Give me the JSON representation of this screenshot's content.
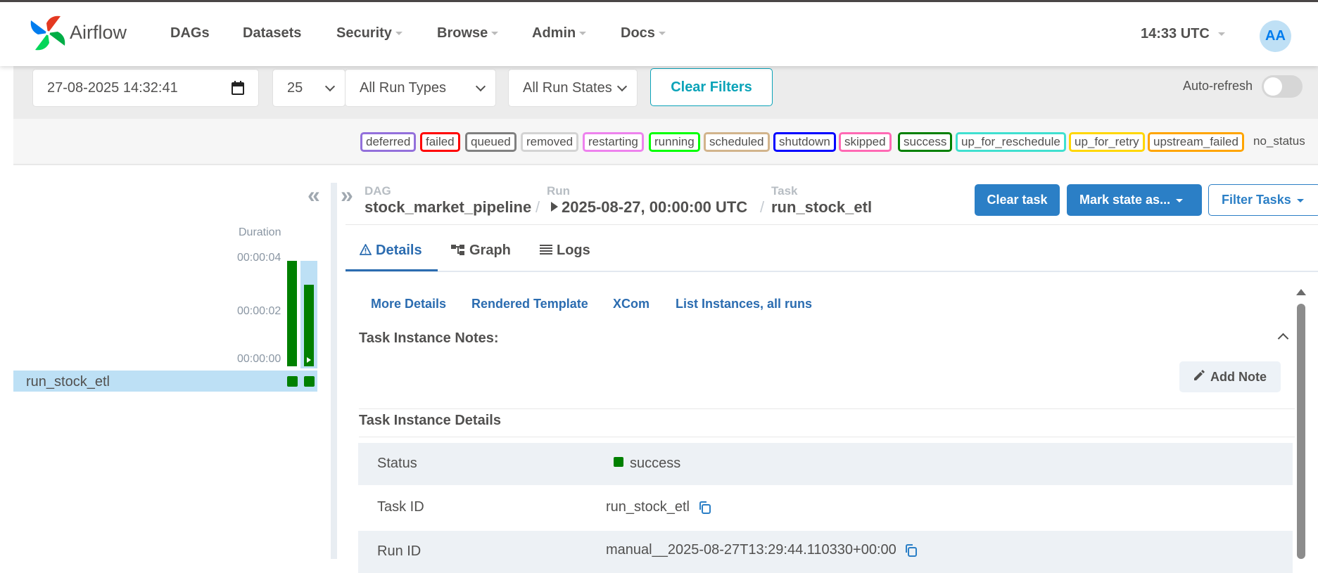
{
  "nav": {
    "brand": "Airflow",
    "items": [
      "DAGs",
      "Datasets",
      "Security",
      "Browse",
      "Admin",
      "Docs"
    ],
    "clock": "14:33 UTC",
    "avatar": "AA"
  },
  "filters": {
    "datetime": "27-08-2025 14:32:41",
    "num_runs": "25",
    "run_types": "All Run Types",
    "run_states": "All Run States",
    "clear_label": "Clear Filters",
    "autorefresh_label": "Auto-refresh",
    "autorefresh_on": false
  },
  "legend": [
    {
      "label": "deferred",
      "color": "#9370db"
    },
    {
      "label": "failed",
      "color": "#ff0000"
    },
    {
      "label": "queued",
      "color": "#808080"
    },
    {
      "label": "removed",
      "color": "#d3d3d3"
    },
    {
      "label": "restarting",
      "color": "#ee82ee"
    },
    {
      "label": "running",
      "color": "#00ff00"
    },
    {
      "label": "scheduled",
      "color": "#d2b48c"
    },
    {
      "label": "shutdown",
      "color": "#0000ff"
    },
    {
      "label": "skipped",
      "color": "#ff69b4"
    },
    {
      "label": "success",
      "color": "#008000"
    },
    {
      "label": "up_for_reschedule",
      "color": "#40e0d0"
    },
    {
      "label": "up_for_retry",
      "color": "#ffd700"
    },
    {
      "label": "upstream_failed",
      "color": "#ffa500"
    },
    {
      "label": "no_status",
      "color": ""
    }
  ],
  "grid": {
    "duration_label": "Duration",
    "ticks": [
      "00:00:04",
      "00:00:02",
      "00:00:00"
    ],
    "run_durations_sec": [
      4,
      3.1
    ],
    "task_name": "run_stock_etl"
  },
  "breadcrumb": {
    "dag_label": "DAG",
    "dag": "stock_market_pipeline",
    "run_label": "Run",
    "run": "2025-08-27, 00:00:00 UTC",
    "task_label": "Task",
    "task": "run_stock_etl"
  },
  "actions": {
    "clear_task": "Clear task",
    "mark_state": "Mark state as...",
    "filter_tasks": "Filter Tasks"
  },
  "tabs": [
    "Details",
    "Graph",
    "Logs"
  ],
  "sublinks": [
    "More Details",
    "Rendered Template",
    "XCom",
    "List Instances, all runs"
  ],
  "notes": {
    "title": "Task Instance Notes:",
    "add_note": "Add Note"
  },
  "details": {
    "title": "Task Instance Details",
    "rows": [
      {
        "label": "Status",
        "value": "success"
      },
      {
        "label": "Task ID",
        "value": "run_stock_etl"
      },
      {
        "label": "Run ID",
        "value": "manual__2025-08-27T13:29:44.110330+00:00"
      }
    ]
  },
  "colors": {
    "accent": "#2b7fc6",
    "success": "#008000",
    "link": "#2b6cb0",
    "teal": "#0aa3b8"
  }
}
